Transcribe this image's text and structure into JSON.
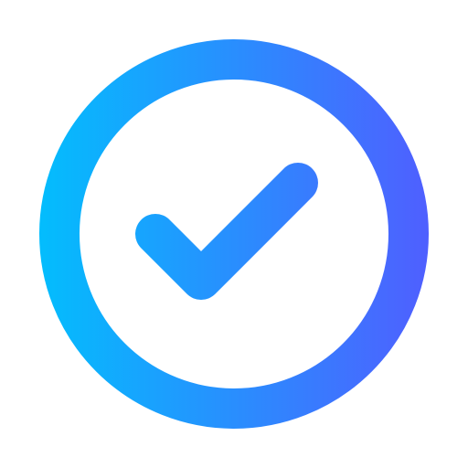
{
  "icon": {
    "name": "check-circle-icon",
    "gradient_start_color": "#03BDFD",
    "gradient_end_color": "#4F5FFF"
  }
}
